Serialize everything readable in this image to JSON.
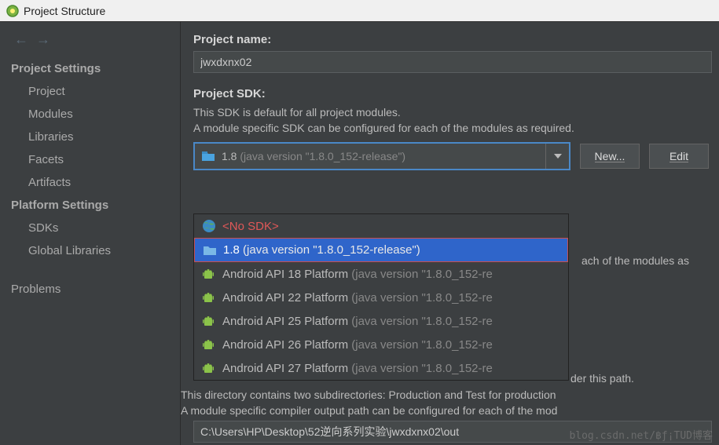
{
  "window": {
    "title": "Project Structure"
  },
  "sidebar": {
    "cat1": "Project Settings",
    "cat2": "Platform Settings",
    "items": [
      "Project",
      "Modules",
      "Libraries",
      "Facets",
      "Artifacts",
      "SDKs",
      "Global Libraries",
      "Problems"
    ]
  },
  "project": {
    "name_label": "Project name:",
    "name_value": "jwxdxnx02",
    "sdk_label": "Project SDK:",
    "sdk_desc1": "This SDK is default for all project modules.",
    "sdk_desc2": "A module specific SDK can be configured for each of the modules as required.",
    "sdk_selected_main": "1.8 ",
    "sdk_selected_dim": "(java version \"1.8.0_152-release\")",
    "btn_new": "New...",
    "btn_edit": "Edit"
  },
  "dropdown": {
    "nosdk": "<No SDK>",
    "opt_main": "1.8 ",
    "opt_dim": "(java version \"1.8.0_152-release\")",
    "a18_m": "Android API 18 Platform ",
    "a18_d": "(java version \"1.8.0_152-re",
    "a22_m": "Android API 22 Platform ",
    "a22_d": "(java version \"1.8.0_152-re",
    "a25_m": "Android API 25 Platform ",
    "a25_d": "(java version \"1.8.0_152-re",
    "a26_m": "Android API 26 Platform ",
    "a26_d": "(java version \"1.8.0_152-re",
    "a27_m": "Android API 27 Platform ",
    "a27_d": "(java version \"1.8.0_152-re"
  },
  "bgtext": {
    "t1": "ach of the modules as",
    "t2": "der this path.",
    "t3": "This directory contains two subdirectories: Production and Test for production",
    "t4": "A module specific compiler output path can be configured for each of the mod",
    "out_path": "C:\\Users\\HP\\Desktop\\52逆向系列实验\\jwxdxnx02\\out"
  },
  "watermark": "blog.csdn.net/฿ƒ¡TUD博客"
}
